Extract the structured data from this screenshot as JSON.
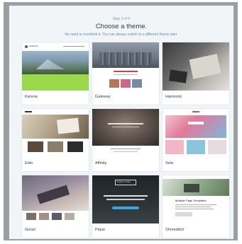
{
  "header": {
    "step": "Step 3 of 4",
    "title": "Choose a theme.",
    "subtitle": "No need to overthink it. You can always switch to a different theme later."
  },
  "themes": [
    {
      "name": "Karuna",
      "site_title": "KARUNA"
    },
    {
      "name": "Gateway"
    },
    {
      "name": "Harmonic"
    },
    {
      "name": "Edin"
    },
    {
      "name": "Affinity"
    },
    {
      "name": "Sela"
    },
    {
      "name": "Goran"
    },
    {
      "name": "Pique",
      "banner": "PIQUE CAFE"
    },
    {
      "name": "Shoreditch",
      "heading": "Multiple Page Templates"
    }
  ],
  "colors": {
    "frame": "#9a9fa3",
    "panel": "#f2f5f8",
    "title": "#2e3d4a",
    "subtitle": "#5b8ec3"
  }
}
